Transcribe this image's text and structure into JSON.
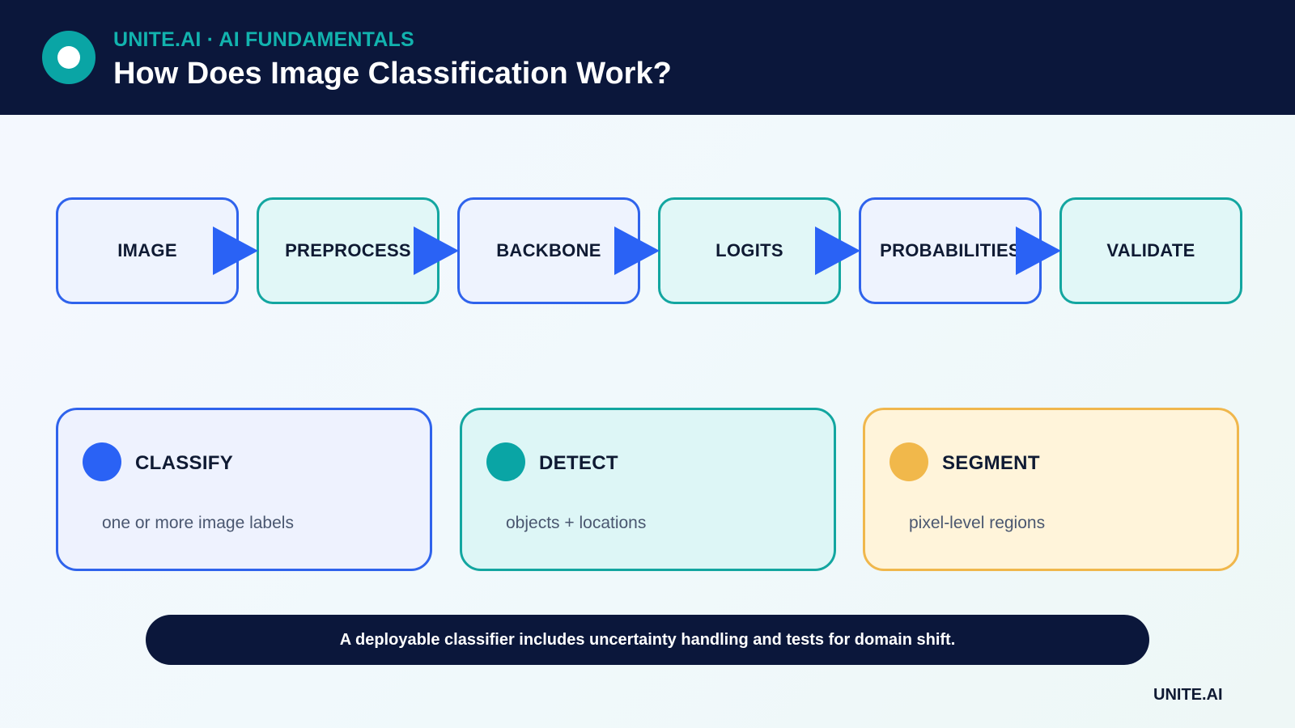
{
  "header": {
    "kicker": "UNITE.AI · AI FUNDAMENTALS",
    "title": "How Does Image Classification Work?"
  },
  "pipeline": [
    {
      "label": "IMAGE"
    },
    {
      "label": "PREPROCESS"
    },
    {
      "label": "BACKBONE"
    },
    {
      "label": "LOGITS"
    },
    {
      "label": "PROBABILITIES"
    },
    {
      "label": "VALIDATE"
    }
  ],
  "tasks": [
    {
      "title": "CLASSIFY",
      "description": "one or more image labels"
    },
    {
      "title": "DETECT",
      "description": "objects + locations"
    },
    {
      "title": "SEGMENT",
      "description": "pixel-level regions"
    }
  ],
  "banner": {
    "text": "A deployable classifier includes uncertainty handling and tests for domain shift."
  },
  "footer": {
    "brand": "UNITE.AI"
  },
  "colors": {
    "navy": "#0b173b",
    "blue": "#2a62f5",
    "teal": "#0aa5a5",
    "amber": "#f1b84b"
  }
}
